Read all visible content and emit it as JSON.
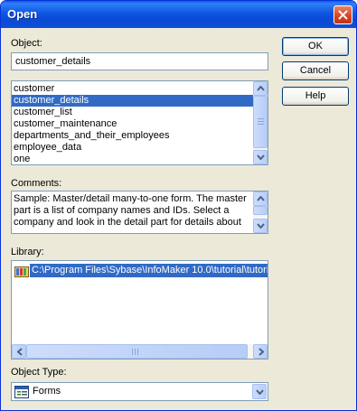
{
  "window": {
    "title": "Open"
  },
  "object": {
    "label": "Object:",
    "value": "customer_details",
    "items": [
      "customer",
      "customer_details",
      "customer_list",
      "customer_maintenance",
      "departments_and_their_employees",
      "employee_data",
      "one"
    ],
    "selected_index": 1
  },
  "buttons": {
    "ok": "OK",
    "cancel": "Cancel",
    "help": "Help"
  },
  "comments": {
    "label": "Comments:",
    "lines": [
      "Sample: Master/detail many-to-one form. The master",
      "part is a list of company names and IDs. Select a",
      "company and look in the detail part for details about"
    ]
  },
  "library": {
    "label": "Library:",
    "items": [
      "C:\\Program Files\\Sybase\\InfoMaker 10.0\\tutorial\\tutori"
    ],
    "icon": "library-icon"
  },
  "object_type": {
    "label": "Object Type:",
    "value": "Forms",
    "icon": "form-icon"
  },
  "colors": {
    "selection": "#316ac5",
    "titlebar": "#0a49d4",
    "dialog": "#ece9d8"
  }
}
